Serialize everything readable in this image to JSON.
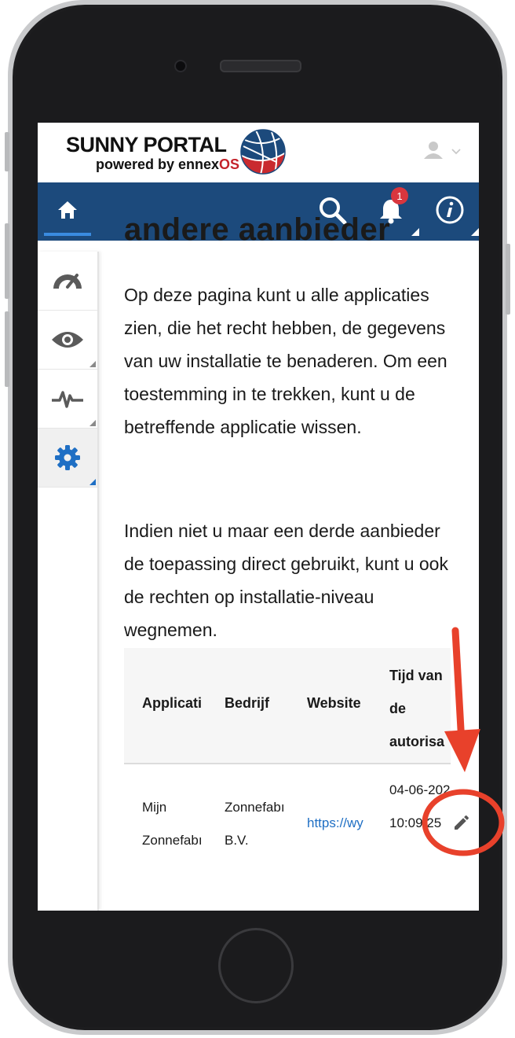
{
  "brand": {
    "title": "SUNNY PORTAL",
    "subtitle_prefix": "powered by ennex",
    "subtitle_suffix": "OS"
  },
  "notifications": {
    "count": "1"
  },
  "page": {
    "heading_partial": "andere aanbieder",
    "paragraph_1": "Op deze pagina kunt u alle applicaties zien, die het recht hebben, de gegevens van uw installatie te benaderen. Om een toestemming in te trekken, kunt u de betreffende applicatie wissen.",
    "paragraph_2": "Indien niet u maar een derde aanbieder de toepassing direct gebruikt, kunt u ook de rechten op installatie-niveau wegnemen."
  },
  "table": {
    "headers": [
      "Applicati",
      "Bedrijf",
      "Website",
      "Tijd van de autorisa"
    ],
    "rows": [
      {
        "application": "Mijn Zonnefabı",
        "company": "Zonnefabı B.V.",
        "website": "https://w​y",
        "time": "04-06-202 10:09:25"
      }
    ]
  },
  "colors": {
    "navbar": "#1c4a7c",
    "accent": "#3a8be0",
    "badge": "#d9363e",
    "annotation": "#e8412b",
    "link": "#1f6fc4"
  },
  "icons": [
    "home-icon",
    "search-icon",
    "bell-icon",
    "info-icon",
    "user-icon",
    "chevron-down-icon",
    "gauge-icon",
    "eye-icon",
    "pulse-icon",
    "gear-icon",
    "pencil-icon"
  ]
}
